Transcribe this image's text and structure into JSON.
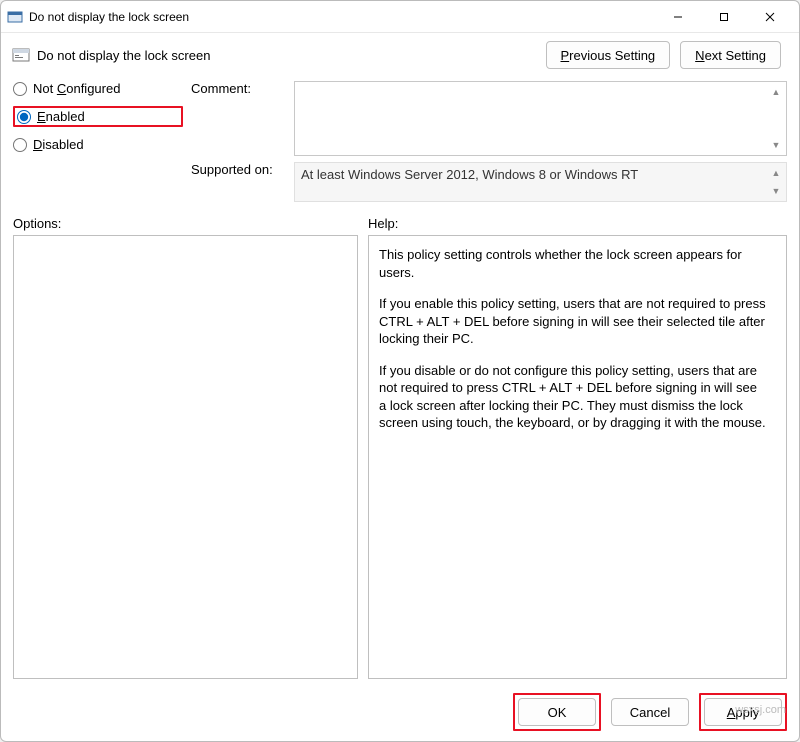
{
  "window": {
    "title": "Do not display the lock screen"
  },
  "header": {
    "policy_name": "Do not display the lock screen",
    "previous": "Previous Setting",
    "next": "Next Setting"
  },
  "state": {
    "not_configured": "Not Configured",
    "enabled": "Enabled",
    "disabled": "Disabled",
    "selected": "enabled"
  },
  "labels": {
    "comment": "Comment:",
    "supported_on": "Supported on:",
    "options": "Options:",
    "help": "Help:"
  },
  "supported": {
    "text": "At least Windows Server 2012, Windows 8 or Windows RT"
  },
  "help": {
    "p1": "This policy setting controls whether the lock screen appears for users.",
    "p2": "If you enable this policy setting, users that are not required to press CTRL + ALT + DEL before signing in will see their selected tile after locking their PC.",
    "p3": "If you disable or do not configure this policy setting, users that are not required to press CTRL + ALT + DEL before signing in will see a lock screen after locking their PC. They must dismiss the lock screen using touch, the keyboard, or by dragging it with the mouse."
  },
  "footer": {
    "ok": "OK",
    "cancel": "Cancel",
    "apply": "Apply"
  },
  "watermark": "wsxsj.com"
}
